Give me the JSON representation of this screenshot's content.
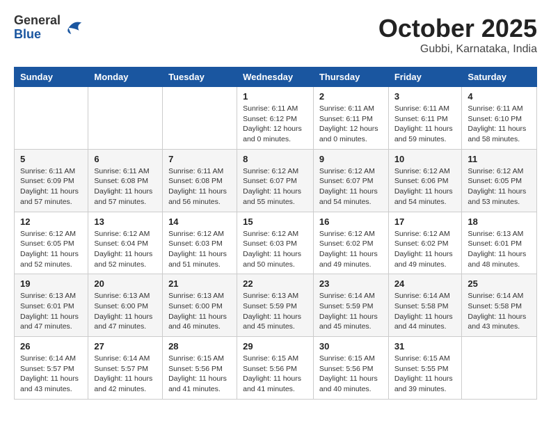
{
  "header": {
    "logo_general": "General",
    "logo_blue": "Blue",
    "month": "October 2025",
    "location": "Gubbi, Karnataka, India"
  },
  "days_of_week": [
    "Sunday",
    "Monday",
    "Tuesday",
    "Wednesday",
    "Thursday",
    "Friday",
    "Saturday"
  ],
  "weeks": [
    [
      {
        "day": "",
        "info": ""
      },
      {
        "day": "",
        "info": ""
      },
      {
        "day": "",
        "info": ""
      },
      {
        "day": "1",
        "info": "Sunrise: 6:11 AM\nSunset: 6:12 PM\nDaylight: 12 hours\nand 0 minutes."
      },
      {
        "day": "2",
        "info": "Sunrise: 6:11 AM\nSunset: 6:11 PM\nDaylight: 12 hours\nand 0 minutes."
      },
      {
        "day": "3",
        "info": "Sunrise: 6:11 AM\nSunset: 6:11 PM\nDaylight: 11 hours\nand 59 minutes."
      },
      {
        "day": "4",
        "info": "Sunrise: 6:11 AM\nSunset: 6:10 PM\nDaylight: 11 hours\nand 58 minutes."
      }
    ],
    [
      {
        "day": "5",
        "info": "Sunrise: 6:11 AM\nSunset: 6:09 PM\nDaylight: 11 hours\nand 57 minutes."
      },
      {
        "day": "6",
        "info": "Sunrise: 6:11 AM\nSunset: 6:08 PM\nDaylight: 11 hours\nand 57 minutes."
      },
      {
        "day": "7",
        "info": "Sunrise: 6:11 AM\nSunset: 6:08 PM\nDaylight: 11 hours\nand 56 minutes."
      },
      {
        "day": "8",
        "info": "Sunrise: 6:12 AM\nSunset: 6:07 PM\nDaylight: 11 hours\nand 55 minutes."
      },
      {
        "day": "9",
        "info": "Sunrise: 6:12 AM\nSunset: 6:07 PM\nDaylight: 11 hours\nand 54 minutes."
      },
      {
        "day": "10",
        "info": "Sunrise: 6:12 AM\nSunset: 6:06 PM\nDaylight: 11 hours\nand 54 minutes."
      },
      {
        "day": "11",
        "info": "Sunrise: 6:12 AM\nSunset: 6:05 PM\nDaylight: 11 hours\nand 53 minutes."
      }
    ],
    [
      {
        "day": "12",
        "info": "Sunrise: 6:12 AM\nSunset: 6:05 PM\nDaylight: 11 hours\nand 52 minutes."
      },
      {
        "day": "13",
        "info": "Sunrise: 6:12 AM\nSunset: 6:04 PM\nDaylight: 11 hours\nand 52 minutes."
      },
      {
        "day": "14",
        "info": "Sunrise: 6:12 AM\nSunset: 6:03 PM\nDaylight: 11 hours\nand 51 minutes."
      },
      {
        "day": "15",
        "info": "Sunrise: 6:12 AM\nSunset: 6:03 PM\nDaylight: 11 hours\nand 50 minutes."
      },
      {
        "day": "16",
        "info": "Sunrise: 6:12 AM\nSunset: 6:02 PM\nDaylight: 11 hours\nand 49 minutes."
      },
      {
        "day": "17",
        "info": "Sunrise: 6:12 AM\nSunset: 6:02 PM\nDaylight: 11 hours\nand 49 minutes."
      },
      {
        "day": "18",
        "info": "Sunrise: 6:13 AM\nSunset: 6:01 PM\nDaylight: 11 hours\nand 48 minutes."
      }
    ],
    [
      {
        "day": "19",
        "info": "Sunrise: 6:13 AM\nSunset: 6:01 PM\nDaylight: 11 hours\nand 47 minutes."
      },
      {
        "day": "20",
        "info": "Sunrise: 6:13 AM\nSunset: 6:00 PM\nDaylight: 11 hours\nand 47 minutes."
      },
      {
        "day": "21",
        "info": "Sunrise: 6:13 AM\nSunset: 6:00 PM\nDaylight: 11 hours\nand 46 minutes."
      },
      {
        "day": "22",
        "info": "Sunrise: 6:13 AM\nSunset: 5:59 PM\nDaylight: 11 hours\nand 45 minutes."
      },
      {
        "day": "23",
        "info": "Sunrise: 6:14 AM\nSunset: 5:59 PM\nDaylight: 11 hours\nand 45 minutes."
      },
      {
        "day": "24",
        "info": "Sunrise: 6:14 AM\nSunset: 5:58 PM\nDaylight: 11 hours\nand 44 minutes."
      },
      {
        "day": "25",
        "info": "Sunrise: 6:14 AM\nSunset: 5:58 PM\nDaylight: 11 hours\nand 43 minutes."
      }
    ],
    [
      {
        "day": "26",
        "info": "Sunrise: 6:14 AM\nSunset: 5:57 PM\nDaylight: 11 hours\nand 43 minutes."
      },
      {
        "day": "27",
        "info": "Sunrise: 6:14 AM\nSunset: 5:57 PM\nDaylight: 11 hours\nand 42 minutes."
      },
      {
        "day": "28",
        "info": "Sunrise: 6:15 AM\nSunset: 5:56 PM\nDaylight: 11 hours\nand 41 minutes."
      },
      {
        "day": "29",
        "info": "Sunrise: 6:15 AM\nSunset: 5:56 PM\nDaylight: 11 hours\nand 41 minutes."
      },
      {
        "day": "30",
        "info": "Sunrise: 6:15 AM\nSunset: 5:56 PM\nDaylight: 11 hours\nand 40 minutes."
      },
      {
        "day": "31",
        "info": "Sunrise: 6:15 AM\nSunset: 5:55 PM\nDaylight: 11 hours\nand 39 minutes."
      },
      {
        "day": "",
        "info": ""
      }
    ]
  ]
}
